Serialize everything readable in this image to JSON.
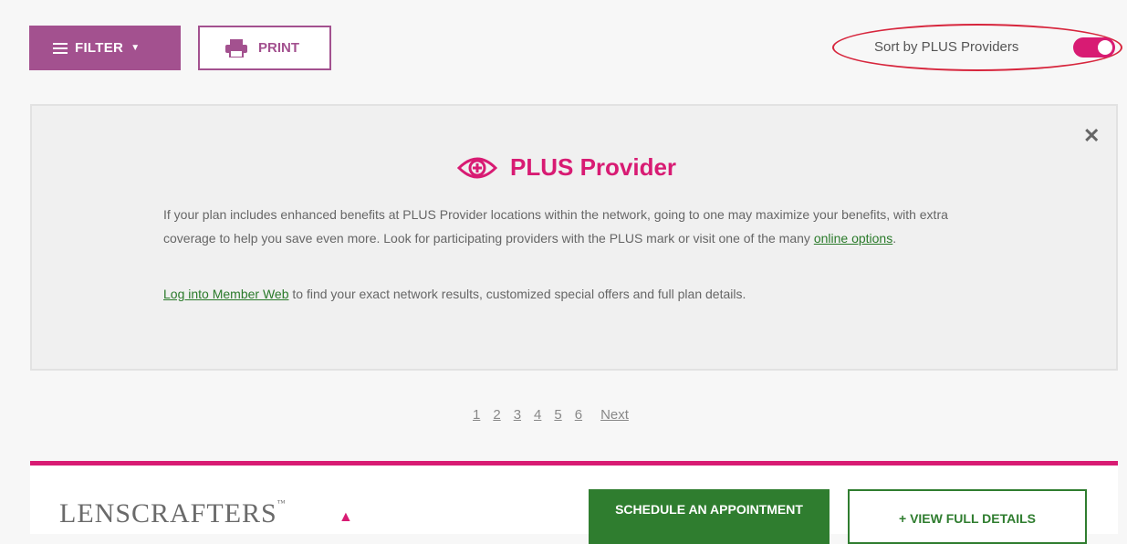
{
  "toolbar": {
    "filter_label": "FILTER",
    "print_label": "PRINT",
    "sort_label": "Sort by PLUS Providers",
    "sort_enabled": true
  },
  "banner": {
    "title": "PLUS Provider",
    "body": "If your plan includes enhanced benefits at PLUS Provider locations within the network, going to one may maximize your benefits, with extra coverage to help you save even more. Look for participating providers with the PLUS mark or visit one of the many ",
    "online_link": "online options",
    "body_end": ".",
    "login_link": "Log into Member Web",
    "login_text": " to find your exact network results, customized special offers and full plan details."
  },
  "pagination": {
    "pages": [
      "1",
      "2",
      "3",
      "4",
      "5",
      "6"
    ],
    "next": "Next"
  },
  "result": {
    "logo_text": "LENSCRAFTERS",
    "schedule_label": "SCHEDULE AN APPOINTMENT",
    "view_label": "+ VIEW FULL DETAILS"
  },
  "colors": {
    "accent": "#d81b73",
    "purple": "#a3518f",
    "green": "#2f7d2f"
  }
}
